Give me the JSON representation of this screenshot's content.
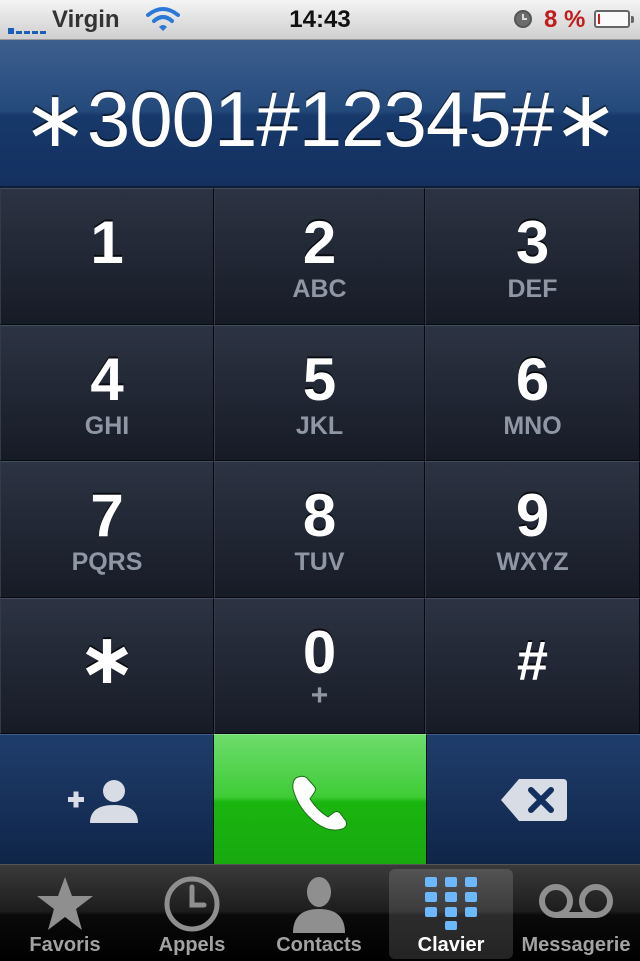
{
  "status_bar": {
    "carrier": "Virgin",
    "time": "14:43",
    "battery_percent": "8 %",
    "battery_level": 0.08,
    "signal_bars": 1
  },
  "display": {
    "number": "∗3001#12345#∗"
  },
  "keypad": {
    "keys": [
      {
        "digit": "1",
        "letters": ""
      },
      {
        "digit": "2",
        "letters": "ABC"
      },
      {
        "digit": "3",
        "letters": "DEF"
      },
      {
        "digit": "4",
        "letters": "GHI"
      },
      {
        "digit": "5",
        "letters": "JKL"
      },
      {
        "digit": "6",
        "letters": "MNO"
      },
      {
        "digit": "7",
        "letters": "PQRS"
      },
      {
        "digit": "8",
        "letters": "TUV"
      },
      {
        "digit": "9",
        "letters": "WXYZ"
      },
      {
        "digit": "∗",
        "letters": ""
      },
      {
        "digit": "0",
        "letters": "+"
      },
      {
        "digit": "#",
        "letters": ""
      }
    ]
  },
  "actions": {
    "add_contact_icon": "add-contact-icon",
    "call_icon": "phone-icon",
    "delete_icon": "backspace-icon",
    "call_color": "#2ac321"
  },
  "tab_bar": {
    "tabs": [
      {
        "label": "Favoris",
        "icon": "star-icon"
      },
      {
        "label": "Appels",
        "icon": "clock-icon"
      },
      {
        "label": "Contacts",
        "icon": "person-icon"
      },
      {
        "label": "Clavier",
        "icon": "keypad-icon"
      },
      {
        "label": "Messagerie",
        "icon": "voicemail-icon"
      }
    ],
    "active_tab": "Clavier"
  }
}
